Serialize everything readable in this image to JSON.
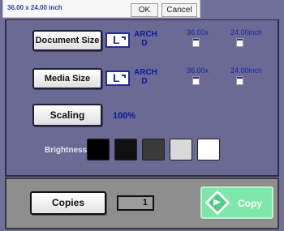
{
  "top": {
    "size_text": "36.00 x 24.00 inch",
    "ok_label": "OK",
    "cancel_label": "Cancel"
  },
  "document_size": {
    "label": "Document Size",
    "paper_line1": "ARCH",
    "paper_line2": "D",
    "orientation": "L",
    "width": "36.00x",
    "height": "24.00inch"
  },
  "media_size": {
    "label": "Media Size",
    "paper_line1": "ARCH",
    "paper_line2": "D",
    "orientation": "L",
    "width": "36.00x",
    "height": "24.00inch"
  },
  "scaling": {
    "label": "Scaling",
    "value": "100%"
  },
  "brightness": {
    "label": "Brightness",
    "levels": [
      "#000000",
      "#111111",
      "#3a3a3a",
      "#d9d9d9",
      "#ffffff"
    ]
  },
  "copies": {
    "label": "Copies",
    "count": "1"
  },
  "copy_button": {
    "label": "Copy",
    "color": "#7ee6a8"
  }
}
